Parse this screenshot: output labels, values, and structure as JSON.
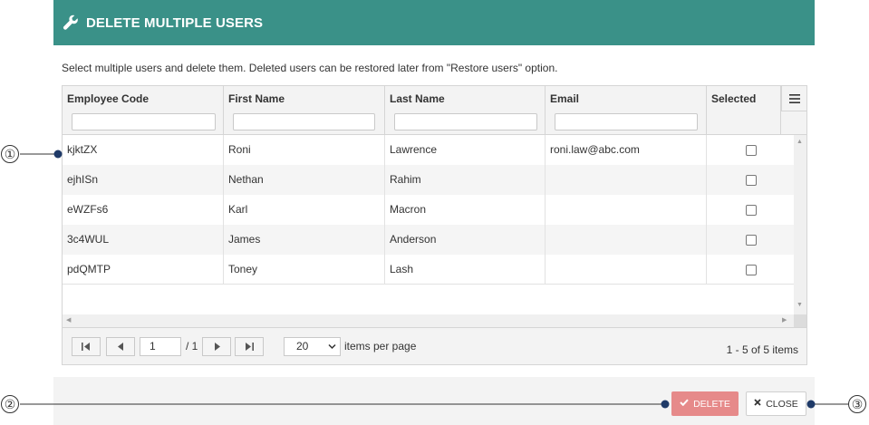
{
  "dialog": {
    "title": "DELETE MULTIPLE USERS",
    "description": "Select multiple users and delete them. Deleted users can be restored later from \"Restore users\" option.",
    "accent_color": "#3a9188"
  },
  "grid": {
    "columns": [
      "Employee Code",
      "First Name",
      "Last Name",
      "Email",
      "Selected"
    ],
    "rows": [
      {
        "code": "kjktZX",
        "first": "Roni",
        "last": "Lawrence",
        "email": "roni.law@abc.com"
      },
      {
        "code": "ejhISn",
        "first": "Nethan",
        "last": "Rahim",
        "email": ""
      },
      {
        "code": "eWZFs6",
        "first": "Karl",
        "last": "Macron",
        "email": ""
      },
      {
        "code": "3c4WUL",
        "first": "James",
        "last": "Anderson",
        "email": ""
      },
      {
        "code": "pdQMTP",
        "first": "Toney",
        "last": "Lash",
        "email": ""
      }
    ]
  },
  "pager": {
    "current_page": "1",
    "total_pages": "/ 1",
    "page_size": "20",
    "items_per_page_label": "items per page",
    "info": "1 - 5 of 5 items"
  },
  "buttons": {
    "delete_label": "DELETE",
    "close_label": "CLOSE",
    "delete_color": "#e68a8a"
  },
  "callouts": [
    "①",
    "②",
    "③"
  ],
  "icons": {
    "header": "wrench-icon",
    "menu": "hamburger-menu-icon",
    "delete": "check-icon",
    "close": "x-icon"
  }
}
